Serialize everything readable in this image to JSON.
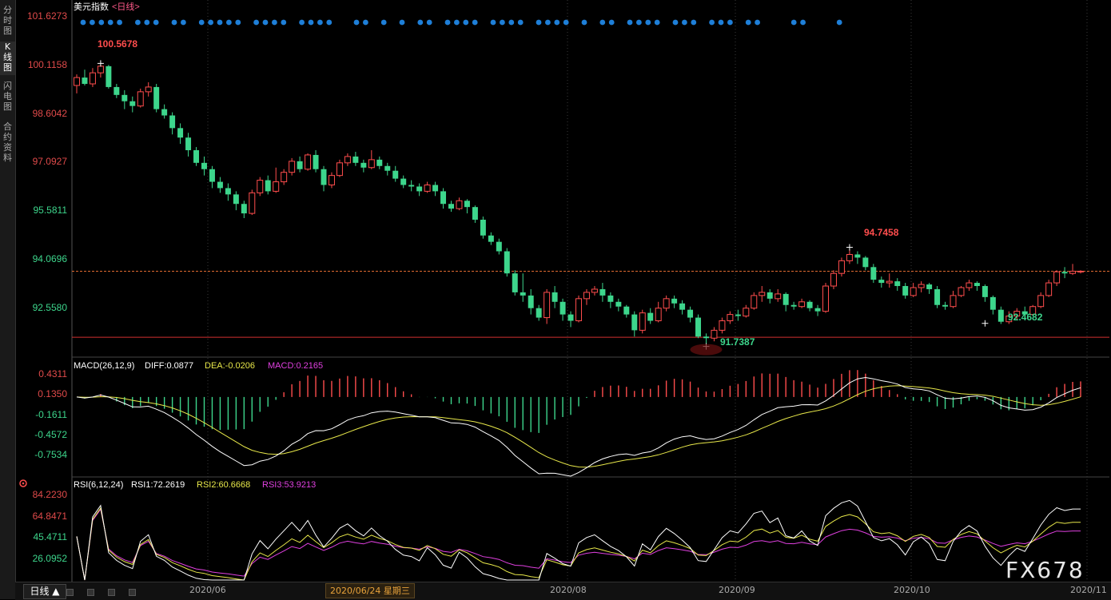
{
  "sidebar": {
    "tabs": [
      {
        "label": "分\n时\n图",
        "active": false
      },
      {
        "label": "K\n线\n图",
        "active": true
      },
      {
        "label": "闪\n电\n图",
        "active": false
      },
      {
        "label": "合\n约\n资\n料",
        "active": false
      }
    ]
  },
  "chart_header": {
    "instrument": "美元指数",
    "timeframe_tag": "<日线>"
  },
  "price_axis": {
    "labels": [
      "101.6273",
      "100.1158",
      "98.6042",
      "97.0927",
      "95.5811",
      "94.0696",
      "92.5580"
    ]
  },
  "annotations": {
    "high_label": "100.5678",
    "local_high_label": "94.7458",
    "low_label": "91.7387",
    "local_low_label": "92.4682",
    "current_price": "94.0696"
  },
  "macd": {
    "title": "MACD(26,12,9)",
    "diff_text": "DIFF:0.0877",
    "dea_text": "DEA:-0.0206",
    "macd_text": "MACD:0.2165",
    "axis_labels": [
      "0.4311",
      "0.1350",
      "-0.1611",
      "-0.4572",
      "-0.7534"
    ]
  },
  "rsi": {
    "title": "RSI(6,12,24)",
    "rsi1_text": "RSI1:72.2619",
    "rsi2_text": "RSI2:60.6668",
    "rsi3_text": "RSI3:53.9213",
    "axis_labels": [
      "84.2230",
      "64.8471",
      "45.4711",
      "26.0952"
    ]
  },
  "time_axis": {
    "labels": [
      "2020/06",
      "2020/08",
      "2020/09",
      "2020/10",
      "2020/11"
    ],
    "crosshair_date": "2020/06/24 星期三"
  },
  "bottom_bar": {
    "timeframe_button": "日线 ▲"
  },
  "watermark": "FX678",
  "colors": {
    "up": "#ff4d4d",
    "down": "#3dd68c",
    "dot": "#1e7fd8",
    "diff": "#ffffff",
    "dea": "#e8e84a",
    "rsi3": "#e040e0"
  },
  "chart_data": {
    "type": "candlestick",
    "price_range": [
      91.4,
      102.2
    ],
    "macd_range": [
      -0.95,
      0.5
    ],
    "rsi_range": [
      10,
      92
    ],
    "candles": [
      [
        99.95,
        100.2,
        99.7,
        100.3
      ],
      [
        100.2,
        100.0,
        99.95,
        100.45
      ],
      [
        100.0,
        100.35,
        99.9,
        100.5
      ],
      [
        100.35,
        100.56,
        100.2,
        100.57
      ],
      [
        100.56,
        99.9,
        99.85,
        100.6
      ],
      [
        99.9,
        99.65,
        99.55,
        100.0
      ],
      [
        99.65,
        99.45,
        99.2,
        99.8
      ],
      [
        99.45,
        99.3,
        99.1,
        99.6
      ],
      [
        99.3,
        99.75,
        99.25,
        99.85
      ],
      [
        99.75,
        99.9,
        99.6,
        100.05
      ],
      [
        99.9,
        99.2,
        99.1,
        100.0
      ],
      [
        99.2,
        99.0,
        98.9,
        99.35
      ],
      [
        99.0,
        98.6,
        98.4,
        99.1
      ],
      [
        98.6,
        98.3,
        98.1,
        98.75
      ],
      [
        98.3,
        97.9,
        97.7,
        98.45
      ],
      [
        97.9,
        97.5,
        97.4,
        98.0
      ],
      [
        97.5,
        97.3,
        97.1,
        97.7
      ],
      [
        97.3,
        96.9,
        96.7,
        97.4
      ],
      [
        96.9,
        96.7,
        96.55,
        97.05
      ],
      [
        96.7,
        96.5,
        96.3,
        96.85
      ],
      [
        96.5,
        96.2,
        96.0,
        96.6
      ],
      [
        96.2,
        95.9,
        95.75,
        96.3
      ],
      [
        95.9,
        96.55,
        95.85,
        96.65
      ],
      [
        96.55,
        96.95,
        96.45,
        97.05
      ],
      [
        96.95,
        96.6,
        96.5,
        97.1
      ],
      [
        96.6,
        96.9,
        96.55,
        97.35
      ],
      [
        96.9,
        97.2,
        96.8,
        97.3
      ],
      [
        97.2,
        97.55,
        97.1,
        97.65
      ],
      [
        97.55,
        97.3,
        97.2,
        97.7
      ],
      [
        97.3,
        97.75,
        97.25,
        97.8
      ],
      [
        97.75,
        97.3,
        97.2,
        97.9
      ],
      [
        97.3,
        96.8,
        96.6,
        97.4
      ],
      [
        96.8,
        97.1,
        96.7,
        97.2
      ],
      [
        97.1,
        97.5,
        97.05,
        97.6
      ],
      [
        97.5,
        97.7,
        97.4,
        97.8
      ],
      [
        97.7,
        97.5,
        97.4,
        97.85
      ],
      [
        97.5,
        97.35,
        97.2,
        97.6
      ],
      [
        97.35,
        97.6,
        97.3,
        97.9
      ],
      [
        97.6,
        97.4,
        97.3,
        97.7
      ],
      [
        97.4,
        97.25,
        97.1,
        97.5
      ],
      [
        97.25,
        97.0,
        96.9,
        97.4
      ],
      [
        97.0,
        96.8,
        96.7,
        97.1
      ],
      [
        96.8,
        96.75,
        96.6,
        96.95
      ],
      [
        96.75,
        96.6,
        96.45,
        96.85
      ],
      [
        96.6,
        96.8,
        96.55,
        96.9
      ],
      [
        96.8,
        96.6,
        96.45,
        96.9
      ],
      [
        96.6,
        96.2,
        96.05,
        96.7
      ],
      [
        96.2,
        96.05,
        95.95,
        96.3
      ],
      [
        96.05,
        96.3,
        96.0,
        96.4
      ],
      [
        96.3,
        96.1,
        95.9,
        96.35
      ],
      [
        96.1,
        95.7,
        95.6,
        96.15
      ],
      [
        95.7,
        95.2,
        95.1,
        95.8
      ],
      [
        95.2,
        95.0,
        94.9,
        95.3
      ],
      [
        95.0,
        94.7,
        94.6,
        95.1
      ],
      [
        94.7,
        94.0,
        93.9,
        94.8
      ],
      [
        94.0,
        93.4,
        93.3,
        94.1
      ],
      [
        93.4,
        93.3,
        93.1,
        94.0
      ],
      [
        93.3,
        92.9,
        92.7,
        93.5
      ],
      [
        92.9,
        92.6,
        92.5,
        93.0
      ],
      [
        92.6,
        93.4,
        92.4,
        93.5
      ],
      [
        93.4,
        93.1,
        92.9,
        93.6
      ],
      [
        93.1,
        92.7,
        92.5,
        93.2
      ],
      [
        92.7,
        92.5,
        92.3,
        92.8
      ],
      [
        92.5,
        93.2,
        92.45,
        93.3
      ],
      [
        93.2,
        93.4,
        93.0,
        93.5
      ],
      [
        93.4,
        93.5,
        93.3,
        93.6
      ],
      [
        93.5,
        93.3,
        93.1,
        93.7
      ],
      [
        93.3,
        93.1,
        92.9,
        93.4
      ],
      [
        93.1,
        92.95,
        92.8,
        93.2
      ],
      [
        92.95,
        92.7,
        92.6,
        93.0
      ],
      [
        92.7,
        92.2,
        92.0,
        92.8
      ],
      [
        92.2,
        92.75,
        92.1,
        92.85
      ],
      [
        92.75,
        92.5,
        92.4,
        92.9
      ],
      [
        92.5,
        92.9,
        92.45,
        93.1
      ],
      [
        92.9,
        93.2,
        92.8,
        93.3
      ],
      [
        93.2,
        93.05,
        92.9,
        93.3
      ],
      [
        93.05,
        92.85,
        92.7,
        93.15
      ],
      [
        92.85,
        92.6,
        92.45,
        92.95
      ],
      [
        92.6,
        92.0,
        91.95,
        92.7
      ],
      [
        92.0,
        91.95,
        91.74,
        92.1
      ],
      [
        91.95,
        92.2,
        91.85,
        92.3
      ],
      [
        92.2,
        92.5,
        92.1,
        92.6
      ],
      [
        92.5,
        92.7,
        92.4,
        92.8
      ],
      [
        92.7,
        92.65,
        92.5,
        92.85
      ],
      [
        92.65,
        92.9,
        92.6,
        93.0
      ],
      [
        92.9,
        93.3,
        92.85,
        93.4
      ],
      [
        93.3,
        93.4,
        93.1,
        93.6
      ],
      [
        93.4,
        93.2,
        93.05,
        93.5
      ],
      [
        93.2,
        93.35,
        93.1,
        93.5
      ],
      [
        93.35,
        93.0,
        92.8,
        93.4
      ],
      [
        93.0,
        92.95,
        92.85,
        93.1
      ],
      [
        92.95,
        93.1,
        92.9,
        93.2
      ],
      [
        93.1,
        92.9,
        92.8,
        93.15
      ],
      [
        92.9,
        92.8,
        92.65,
        93.0
      ],
      [
        92.8,
        93.6,
        92.75,
        93.7
      ],
      [
        93.6,
        94.0,
        93.5,
        94.1
      ],
      [
        94.0,
        94.4,
        93.9,
        94.5
      ],
      [
        94.4,
        94.6,
        94.3,
        94.75
      ],
      [
        94.6,
        94.5,
        94.3,
        94.7
      ],
      [
        94.5,
        94.2,
        94.1,
        94.55
      ],
      [
        94.2,
        93.8,
        93.7,
        94.3
      ],
      [
        93.8,
        93.7,
        93.55,
        93.9
      ],
      [
        93.7,
        93.75,
        93.55,
        94.0
      ],
      [
        93.75,
        93.6,
        93.45,
        93.85
      ],
      [
        93.6,
        93.3,
        93.2,
        93.7
      ],
      [
        93.3,
        93.55,
        93.25,
        93.7
      ],
      [
        93.55,
        93.65,
        93.4,
        93.75
      ],
      [
        93.65,
        93.5,
        93.35,
        93.7
      ],
      [
        93.5,
        93.0,
        92.9,
        93.6
      ],
      [
        93.0,
        92.95,
        92.85,
        93.1
      ],
      [
        92.95,
        93.3,
        92.9,
        93.45
      ],
      [
        93.3,
        93.55,
        93.25,
        93.6
      ],
      [
        93.55,
        93.7,
        93.45,
        93.8
      ],
      [
        93.7,
        93.6,
        93.45,
        93.75
      ],
      [
        93.6,
        93.25,
        93.1,
        93.65
      ],
      [
        93.25,
        92.85,
        92.7,
        93.3
      ],
      [
        92.85,
        92.47,
        92.4,
        92.95
      ],
      [
        92.47,
        92.65,
        92.4,
        92.8
      ],
      [
        92.65,
        92.8,
        92.55,
        92.9
      ],
      [
        92.8,
        92.7,
        92.55,
        92.95
      ],
      [
        92.7,
        92.95,
        92.65,
        93.0
      ],
      [
        92.95,
        93.3,
        92.9,
        93.4
      ],
      [
        93.3,
        93.7,
        93.25,
        93.8
      ],
      [
        93.7,
        94.05,
        93.6,
        94.1
      ],
      [
        94.05,
        94.0,
        93.85,
        94.2
      ],
      [
        94.0,
        94.07,
        93.95,
        94.3
      ],
      [
        94.07,
        94.07,
        94.0,
        94.1
      ]
    ],
    "markers": {
      "high": {
        "candle_index": 3,
        "value": 100.5678
      },
      "local_high": {
        "candle_index": 97,
        "value": 94.7458
      },
      "low": {
        "candle_index": 79,
        "value": 91.7387
      },
      "local_low": {
        "candle_index": 114,
        "value": 92.4682
      }
    },
    "support_level": 91.98,
    "current_price": 94.0696,
    "macd_series": {
      "diff_range_start": 0.1,
      "dea_range_start": 0.08
    },
    "rsi_levels_last": {
      "rsi1": 72.2619,
      "rsi2": 60.6668,
      "rsi3": 53.9213
    },
    "dot_row_count": 74
  }
}
